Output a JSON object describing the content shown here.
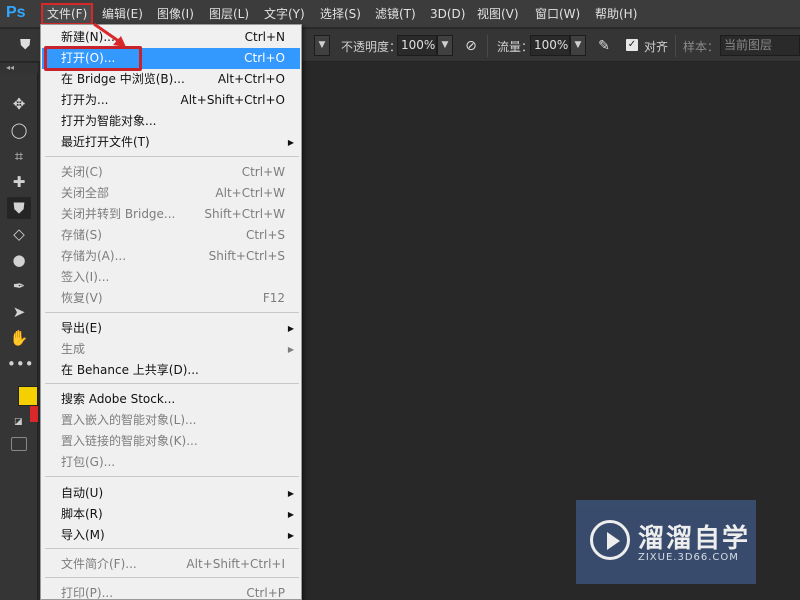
{
  "app": {
    "logo": "Ps"
  },
  "menubar": {
    "items": [
      {
        "label": "文件(F)",
        "active": true
      },
      {
        "label": "编辑(E)"
      },
      {
        "label": "图像(I)"
      },
      {
        "label": "图层(L)"
      },
      {
        "label": "文字(Y)"
      },
      {
        "label": "选择(S)"
      },
      {
        "label": "滤镜(T)"
      },
      {
        "label": "3D(D)"
      },
      {
        "label": "视图(V)"
      },
      {
        "label": "窗口(W)"
      },
      {
        "label": "帮助(H)"
      }
    ]
  },
  "options": {
    "opacity_label": "不透明度：",
    "opacity_value": "100%",
    "flow_label": "流量：",
    "flow_value": "100%",
    "align_label": "对齐",
    "align_checked": true,
    "sample_label": "样本：",
    "sample_value": "当前图层"
  },
  "file_menu": {
    "items": [
      {
        "label": "新建(N)...",
        "shortcut": "Ctrl+N"
      },
      {
        "label": "打开(O)...",
        "shortcut": "Ctrl+O",
        "highlighted": true
      },
      {
        "label": "在 Bridge 中浏览(B)...",
        "shortcut": "Alt+Ctrl+O"
      },
      {
        "label": "打开为...",
        "shortcut": "Alt+Shift+Ctrl+O"
      },
      {
        "label": "打开为智能对象..."
      },
      {
        "label": "最近打开文件(T)",
        "submenu": true
      },
      {
        "label": "关闭(C)",
        "shortcut": "Ctrl+W",
        "disabled": true
      },
      {
        "label": "关闭全部",
        "shortcut": "Alt+Ctrl+W",
        "disabled": true
      },
      {
        "label": "关闭并转到 Bridge...",
        "shortcut": "Shift+Ctrl+W",
        "disabled": true
      },
      {
        "label": "存储(S)",
        "shortcut": "Ctrl+S",
        "disabled": true
      },
      {
        "label": "存储为(A)...",
        "shortcut": "Shift+Ctrl+S",
        "disabled": true
      },
      {
        "label": "签入(I)...",
        "disabled": true
      },
      {
        "label": "恢复(V)",
        "shortcut": "F12",
        "disabled": true
      },
      {
        "label": "导出(E)",
        "submenu": true
      },
      {
        "label": "生成",
        "submenu": true,
        "disabled": true
      },
      {
        "label": "在 Behance 上共享(D)..."
      },
      {
        "label": "搜索 Adobe Stock..."
      },
      {
        "label": "置入嵌入的智能对象(L)...",
        "disabled": true
      },
      {
        "label": "置入链接的智能对象(K)...",
        "disabled": true
      },
      {
        "label": "打包(G)...",
        "disabled": true
      },
      {
        "label": "自动(U)",
        "submenu": true
      },
      {
        "label": "脚本(R)",
        "submenu": true
      },
      {
        "label": "导入(M)",
        "submenu": true
      },
      {
        "label": "文件简介(F)...",
        "shortcut": "Alt+Shift+Ctrl+I",
        "disabled": true
      },
      {
        "label": "打印(P)...",
        "shortcut": "Ctrl+P",
        "disabled": true
      }
    ]
  },
  "colors": {
    "foreground": "#f5d000",
    "background": "#d8282a",
    "highlight": "#3399ff"
  },
  "watermark": {
    "title": "溜溜自学",
    "subtitle": "ZIXUE.3D66.COM"
  }
}
